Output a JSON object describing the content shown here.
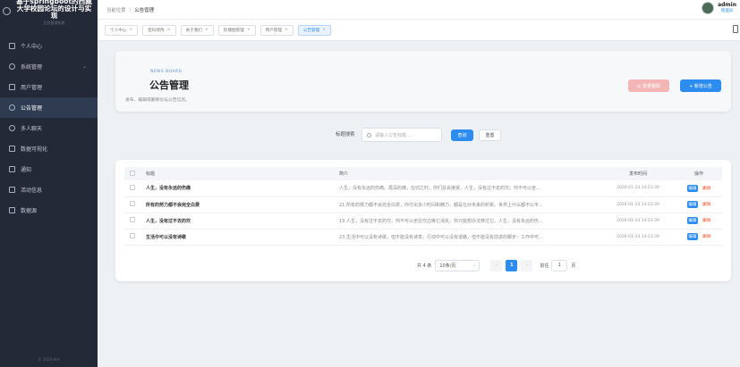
{
  "brand": {
    "title": "基于springboot的西藏大学校园论坛的设计与实现",
    "subtitle": "后台管理系统"
  },
  "sidebar": {
    "items": [
      {
        "label": "个人中心"
      },
      {
        "label": "系统管理",
        "arrow": "⌄"
      },
      {
        "label": "用户管理"
      },
      {
        "label": "公告管理"
      },
      {
        "label": "多人聊天"
      },
      {
        "label": "数据可视化"
      },
      {
        "label": "通知"
      },
      {
        "label": "活动信息"
      },
      {
        "label": "数据源"
      }
    ],
    "copyright": "© 2024 Hot"
  },
  "header": {
    "crumb_home": "当前位置",
    "crumb_sep": "/",
    "crumb_current": "公告管理",
    "user_name": "admin",
    "user_role": "管理员"
  },
  "tags": [
    {
      "label": "个人中心"
    },
    {
      "label": "密码修改"
    },
    {
      "label": "关于我们"
    },
    {
      "label": "轮播图管理"
    },
    {
      "label": "用户管理"
    },
    {
      "label": "公告管理"
    }
  ],
  "tag_close": "×",
  "hero": {
    "eyebrow": "NEWS BOARD",
    "title": "公告管理",
    "desc": "发布、编辑或删除论坛公告信息。",
    "batch_delete": "◎ 批量删除",
    "add": "+ 新增公告"
  },
  "search": {
    "label": "标题搜索",
    "placeholder": "请输入公告标题...",
    "query": "查询",
    "reset": "重置"
  },
  "table": {
    "headers": {
      "title": "标题",
      "intro": "简介",
      "time": "发布时间",
      "ops": "操作"
    },
    "edit": "编辑",
    "delete": "删除",
    "rows": [
      {
        "title": "人生，没有永远的伤痛",
        "intro": "人生，没有永远的伤痛。再深的痛，在切之时，你们总会接受。人生，没有过不去的坎。你不可以坐...",
        "time": "2026-01-24 14:23:39"
      },
      {
        "title": "所有的努力都不会完全白费",
        "intro": "21.所有的努力都不会完全白费，你付出多少时间和精力，都是在对未来的积累。世界上什么都不公平...",
        "time": "2026-01-24 14:23:39"
      },
      {
        "title": "人生，没有过不去的坎",
        "intro": "19.人生，没有过不去的坎，你不可以坐在坎边等它消失，你只能想办法穿过它。人生，没有永远的伤...",
        "time": "2026-01-24 14:23:39"
      },
      {
        "title": "生活中可以没有诗歌",
        "intro": "23.生活中可以没有诗歌，但不能没有诗意；行动中可以没有道路，但不能没有前进的脚步：工作中可...",
        "time": "2026-01-24 14:23:39"
      }
    ]
  },
  "pager": {
    "total": "共 4 条",
    "size": "10条/页",
    "size_caret": "⌄",
    "prev": "‹",
    "page": "1",
    "next": "›",
    "goto": "前往",
    "goto_value": "1",
    "unit": "页"
  }
}
